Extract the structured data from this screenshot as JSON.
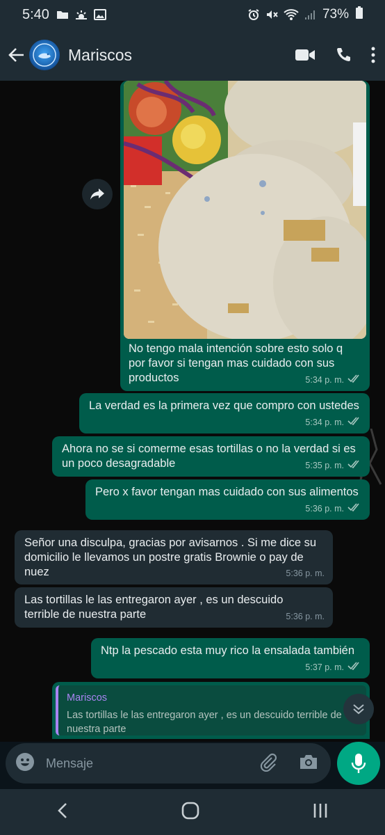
{
  "status_bar": {
    "time": "5:40",
    "battery": "73%"
  },
  "header": {
    "title": "Mariscos"
  },
  "messages": [
    {
      "type": "image",
      "caption": "No tengo mala intención sobre esto solo q por favor si tengan mas cuidado con sus productos",
      "time": "5:34 p. m."
    },
    {
      "type": "out",
      "text": "La verdad es la primera vez que compro con ustedes",
      "time": "5:34 p. m."
    },
    {
      "type": "out",
      "text": "Ahora no se si comerme esas tortillas o no la verdad si es un poco desagradable",
      "time": "5:35 p. m."
    },
    {
      "type": "out",
      "text": "Pero x favor tengan mas cuidado con sus alimentos",
      "time": "5:36 p. m."
    },
    {
      "type": "in",
      "text": "Señor una disculpa, gracias por avisarnos . Si me dice su domicilio le llevamos un postre gratis Brownie o pay de nuez",
      "time": "5:36 p. m."
    },
    {
      "type": "in",
      "text": "Las tortillas le las entregaron ayer , es un descuido terrible de nuestra parte",
      "time": "5:36 p. m."
    },
    {
      "type": "out",
      "text": "Ntp  la pescado esta muy rico la ensalada también",
      "time": "5:37 p. m."
    },
    {
      "type": "reply",
      "quote_author": "Mariscos",
      "quote_text": "Las tortillas le las entregaron ayer , es un descuido terrible de nuestra parte"
    }
  ],
  "composer": {
    "placeholder": "Mensaje"
  },
  "colors": {
    "outgoing": "#005c4b",
    "incoming": "#202c33",
    "accent": "#00a884",
    "header": "#1f2c34"
  }
}
